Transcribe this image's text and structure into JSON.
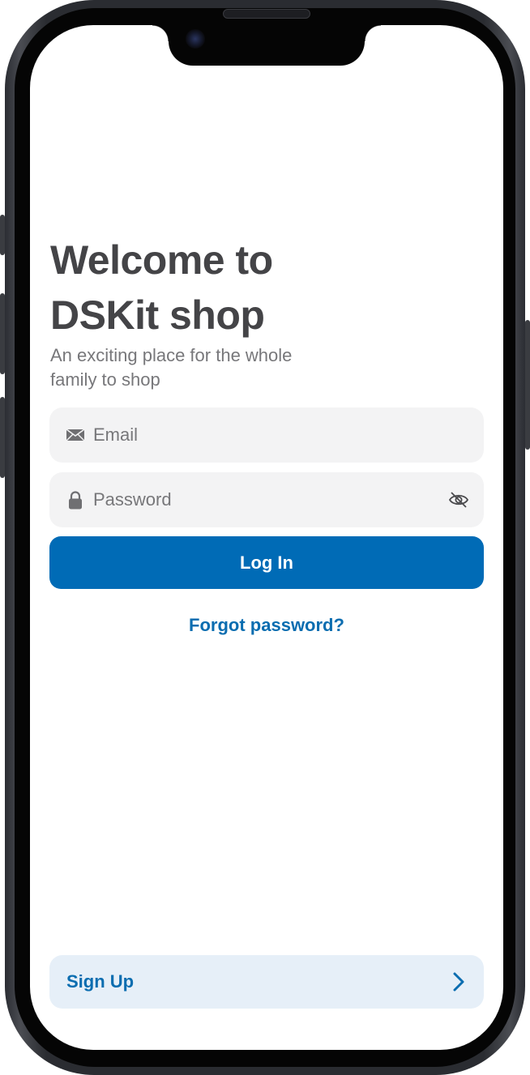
{
  "welcome": {
    "title_line1": "Welcome to",
    "title_line2": "DSKit shop",
    "subtitle_line1": "An exciting place for the whole",
    "subtitle_line2": "family to shop"
  },
  "form": {
    "email_placeholder": "Email",
    "password_placeholder": "Password",
    "email_icon": "envelope-icon",
    "password_icon": "lock-icon",
    "visibility_icon": "eye-slash-icon",
    "login_label": "Log In",
    "forgot_label": "Forgot password?"
  },
  "footer": {
    "signup_label": "Sign Up",
    "signup_icon": "chevron-right-icon"
  },
  "colors": {
    "primary": "#006bb6",
    "link": "#0b6db0",
    "field_bg": "#f3f3f4",
    "signup_bg": "#e6eff8",
    "title_text": "#444447",
    "muted_text": "#77777a"
  }
}
